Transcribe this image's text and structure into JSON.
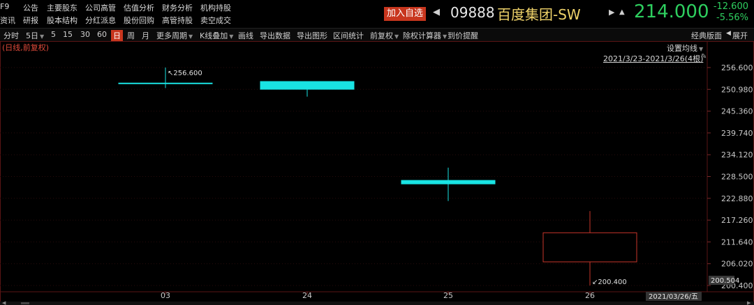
{
  "header": {
    "row1": [
      "F9",
      "公告",
      "主要股东",
      "公司高管",
      "估值分析",
      "财务分析",
      "机构持股"
    ],
    "row2": [
      "资讯",
      "研报",
      "股本结构",
      "分红派息",
      "股份回购",
      "高管持股",
      "卖空成交"
    ],
    "add_label": "加入自选",
    "code": "09888",
    "name": "百度集团-SW",
    "price": "214.000",
    "change": "-12.600",
    "change_pct": "-5.56%",
    "price_color": "#2ecf5f"
  },
  "toolbar": {
    "items": [
      "分时",
      "5日",
      "5",
      "15",
      "30",
      "60",
      "日",
      "周",
      "月",
      "更多周期",
      "K线叠加",
      "画线",
      "导出数据",
      "导出图形",
      "区间统计",
      "前复权",
      "除权计算器",
      "到价提醒"
    ],
    "active": "日",
    "right_items": [
      "经典版面",
      "展开"
    ]
  },
  "chart_meta": {
    "subtitle": "(日线,前复权)",
    "set_ma": "设置均线",
    "range_label": "2021/3/23-2021/3/26(4根)",
    "last_label": "200.504",
    "date_label": "2021/03/26/五",
    "high_annotation": "256.600",
    "low_annotation": "200.400"
  },
  "chart_data": {
    "type": "candlestick",
    "ylim": [
      200.4,
      256.6
    ],
    "y_ticks": [
      "256.600",
      "250.980",
      "245.360",
      "239.740",
      "234.120",
      "228.500",
      "222.880",
      "217.260",
      "211.640",
      "206.020",
      "200.400"
    ],
    "categories": [
      "03",
      "24",
      "25",
      "26"
    ],
    "candles": [
      {
        "date": "03",
        "open": 252.6,
        "high": 256.6,
        "low": 251.3,
        "close": 252.6,
        "color": "#19e3e3"
      },
      {
        "date": "24",
        "open": 253.0,
        "high": 253.0,
        "low": 249.1,
        "close": 251.0,
        "color": "#19e3e3"
      },
      {
        "date": "25",
        "open": 227.5,
        "high": 230.8,
        "low": 222.2,
        "close": 226.6,
        "color": "#19e3e3"
      },
      {
        "date": "26",
        "open": 206.5,
        "high": 219.6,
        "low": 200.4,
        "close": 214.0,
        "color": "#c8362a"
      }
    ],
    "up_color": "#c8362a",
    "down_color": "#19e3e3"
  }
}
